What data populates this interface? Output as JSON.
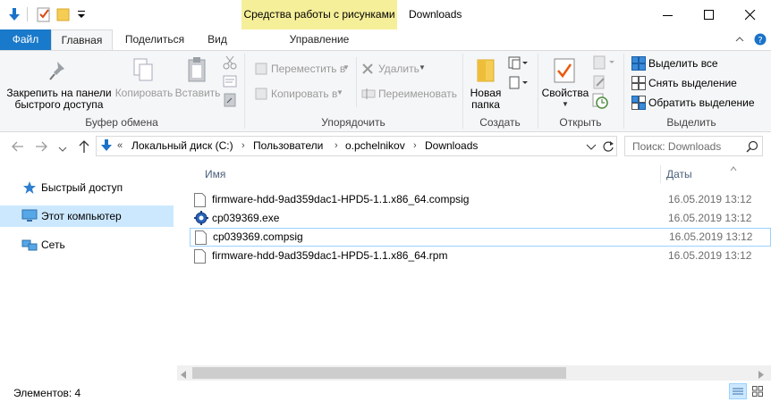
{
  "titlebar": {
    "context_tab": "Средства работы с рисунками",
    "window_title": "Downloads"
  },
  "tabs": {
    "file": "Файл",
    "home": "Главная",
    "share": "Поделиться",
    "view": "Вид",
    "manage": "Управление"
  },
  "ribbon": {
    "clipboard": {
      "pin_line1": "Закрепить на панели",
      "pin_line2": "быстрого доступа",
      "copy": "Копировать",
      "paste": "Вставить",
      "group": "Буфер обмена"
    },
    "organize": {
      "move_to": "Переместить в",
      "copy_to": "Копировать в",
      "delete": "Удалить",
      "rename": "Переименовать",
      "group": "Упорядочить"
    },
    "new": {
      "new_folder_line1": "Новая",
      "new_folder_line2": "папка",
      "group": "Создать"
    },
    "open": {
      "properties": "Свойства",
      "group": "Открыть"
    },
    "select": {
      "select_all": "Выделить все",
      "select_none": "Снять выделение",
      "invert": "Обратить выделение",
      "group": "Выделить"
    }
  },
  "address": {
    "overflow": "«",
    "crumbs": [
      "Локальный диск (C:)",
      "Пользователи",
      "o.pchelnikov",
      "Downloads"
    ],
    "search_placeholder": "Поиск: Downloads"
  },
  "nav": {
    "quick_access": "Быстрый доступ",
    "this_pc": "Этот компьютер",
    "network": "Сеть"
  },
  "list": {
    "col_name": "Имя",
    "col_date": "Даты",
    "files": [
      {
        "name": "firmware-hdd-9ad359dac1-HPD5-1.1.x86_64.compsig",
        "date": "16.05.2019 13:12",
        "icon": "document-icon"
      },
      {
        "name": "cp039369.exe",
        "date": "16.05.2019 13:12",
        "icon": "installer-icon"
      },
      {
        "name": "cp039369.compsig",
        "date": "16.05.2019 13:12",
        "icon": "document-icon"
      },
      {
        "name": "firmware-hdd-9ad359dac1-HPD5-1.1.x86_64.rpm",
        "date": "16.05.2019 13:12",
        "icon": "document-icon"
      }
    ]
  },
  "status": {
    "items": "Элементов: 4"
  },
  "colors": {
    "file_tab": "#1979ca",
    "context_tab": "#f6ef9a",
    "selection": "#cce8ff"
  }
}
